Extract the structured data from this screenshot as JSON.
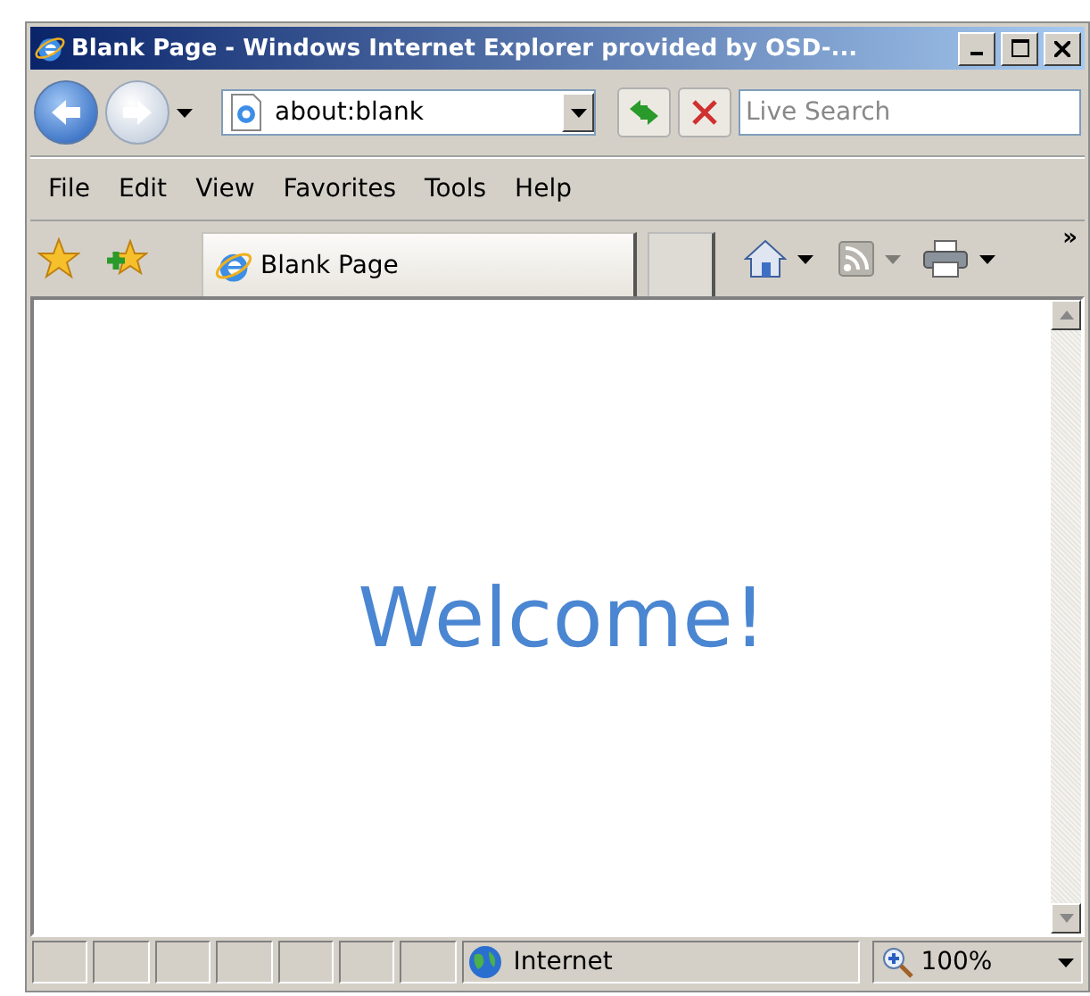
{
  "window": {
    "title": "Blank Page - Windows Internet Explorer provided by OSD-..."
  },
  "address_bar": {
    "value": "about:blank"
  },
  "search": {
    "placeholder": "Live Search"
  },
  "menu": [
    "File",
    "Edit",
    "View",
    "Favorites",
    "Tools",
    "Help"
  ],
  "tab": {
    "label": "Blank Page"
  },
  "toolbar_overflow": "»",
  "page": {
    "heading": "Welcome!"
  },
  "status_bar": {
    "zone": "Internet",
    "zoom": "100%"
  }
}
